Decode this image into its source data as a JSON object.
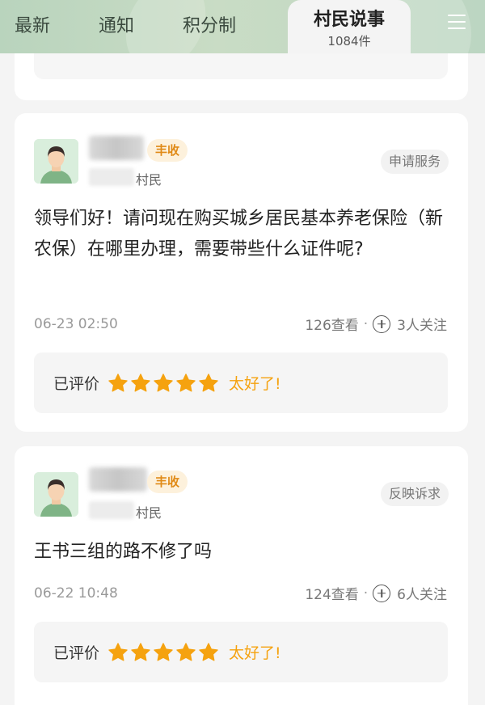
{
  "tabs": [
    {
      "label": "最新"
    },
    {
      "label": "通知"
    },
    {
      "label": "积分制"
    }
  ],
  "active_tab": {
    "label": "村民说事",
    "count": "1084件"
  },
  "colors": {
    "accent": "#e08a17",
    "star": "#f5a20f",
    "tabbar": "#c9dcc5"
  },
  "posts": [
    {
      "badge": "丰收",
      "role": "村民",
      "category": "申请服务",
      "content": "领导们好！请问现在购买城乡居民基本养老保险（新农保）在哪里办理，需要带些什么证件呢?",
      "time": "06-23 02:50",
      "views": "126查看",
      "follow": "3人关注",
      "rating_label": "已评价",
      "rating_stars": 5,
      "rating_text": "太好了!"
    },
    {
      "badge": "丰收",
      "role": "村民",
      "category": "反映诉求",
      "content": "王书三组的路不修了吗",
      "time": "06-22 10:48",
      "views": "124查看",
      "follow": "6人关注",
      "rating_label": "已评价",
      "rating_stars": 5,
      "rating_text": "太好了!"
    }
  ]
}
